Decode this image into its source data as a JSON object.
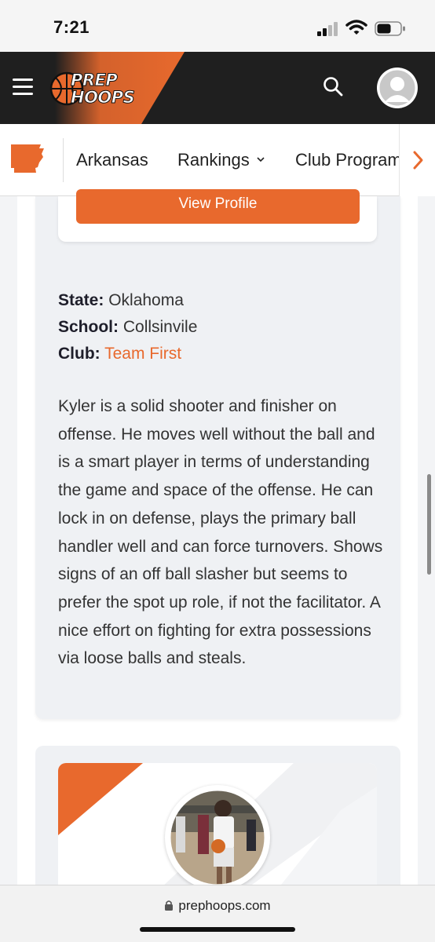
{
  "status_bar": {
    "time": "7:21"
  },
  "header": {
    "logo_line1": "PREP",
    "logo_line2": "HOOPS"
  },
  "subnav": {
    "items": [
      {
        "label": "Arkansas"
      },
      {
        "label": "Rankings"
      },
      {
        "label": "Club Program"
      }
    ]
  },
  "profile": {
    "view_profile_label": "View Profile",
    "state_label": "State:",
    "state_value": "Oklahoma",
    "school_label": "School:",
    "school_value": "Collsinvile",
    "club_label": "Club:",
    "club_value": "Team First",
    "bio": "Kyler is a solid shooter and finisher on offense. He moves well without the ball and is a smart player in terms of understanding the game and space of the offense. He can lock in on defense, plays the primary ball handler well and can force turnovers. Shows signs of an off ball slasher but seems to prefer the spot up role, if not the facilitator. A nice effort on fighting for extra possessions via loose balls and steals."
  },
  "browser": {
    "url": "prephoops.com"
  },
  "colors": {
    "accent": "#e8692d",
    "header_bg": "#1f1f1f",
    "card_bg": "#eff1f4"
  }
}
